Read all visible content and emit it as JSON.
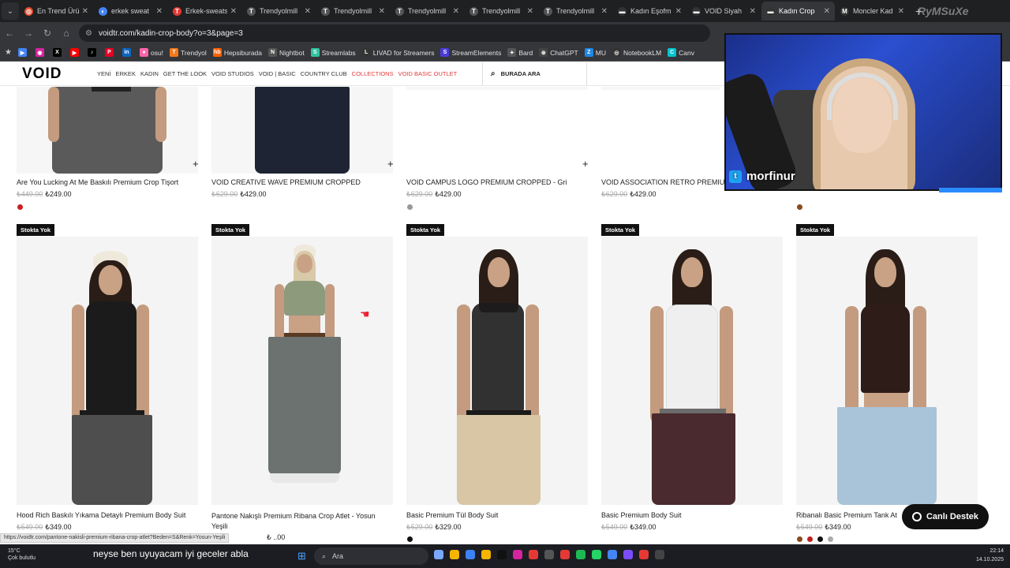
{
  "browser": {
    "tabs": [
      {
        "title": "En Trend Ürü",
        "icon_color": "#e54b2b",
        "icon_glyph": "◎",
        "active": false
      },
      {
        "title": "erkek sweat",
        "icon_color": "#4285f4",
        "icon_glyph": "◐",
        "active": false
      },
      {
        "title": "Erkek-sweats",
        "icon_color": "#e53935",
        "icon_glyph": "T",
        "active": false
      },
      {
        "title": "Trendyolmill",
        "icon_color": "#555",
        "icon_glyph": "T",
        "active": false
      },
      {
        "title": "Trendyolmill",
        "icon_color": "#555",
        "icon_glyph": "T",
        "active": false
      },
      {
        "title": "Trendyolmill",
        "icon_color": "#555",
        "icon_glyph": "T",
        "active": false
      },
      {
        "title": "Trendyolmill",
        "icon_color": "#555",
        "icon_glyph": "T",
        "active": false
      },
      {
        "title": "Trendyolmill",
        "icon_color": "#555",
        "icon_glyph": "T",
        "active": false
      },
      {
        "title": "Kadın Eşofm",
        "icon_color": "#333",
        "icon_glyph": "▬",
        "active": false
      },
      {
        "title": "VOID Siyah",
        "icon_color": "#333",
        "icon_glyph": "▬",
        "active": false
      },
      {
        "title": "Kadın Crop",
        "icon_color": "#333",
        "icon_glyph": "▬",
        "active": true
      },
      {
        "title": "Moncler Kad",
        "icon_color": "#333",
        "icon_glyph": "M",
        "active": false
      }
    ],
    "url": "voidtr.com/kadin-crop-body?o=3&page=3",
    "bookmarks": [
      {
        "label": "",
        "color": "#4285f4",
        "glyph": "▶"
      },
      {
        "label": "",
        "color": "#d6249f",
        "glyph": "◉"
      },
      {
        "label": "",
        "color": "#000",
        "glyph": "X"
      },
      {
        "label": "",
        "color": "#ff0000",
        "glyph": "▶"
      },
      {
        "label": "",
        "color": "#000",
        "glyph": "♪"
      },
      {
        "label": "",
        "color": "#e60023",
        "glyph": "P"
      },
      {
        "label": "",
        "color": "#0a66c2",
        "glyph": "in"
      },
      {
        "label": "osu!",
        "color": "#ff66aa",
        "glyph": "●"
      },
      {
        "label": "Trendyol",
        "color": "#f27a1a",
        "glyph": "T"
      },
      {
        "label": "Hepsiburada",
        "color": "#ff6000",
        "glyph": "hb"
      },
      {
        "label": "Nightbot",
        "color": "#555",
        "glyph": "N"
      },
      {
        "label": "Streamlabs",
        "color": "#31c3a2",
        "glyph": "S"
      },
      {
        "label": "LIVAD for Streamers",
        "color": "#333",
        "glyph": "L"
      },
      {
        "label": "StreamElements",
        "color": "#4b3bdb",
        "glyph": "S"
      },
      {
        "label": "Bard",
        "color": "#555",
        "glyph": "✦"
      },
      {
        "label": "ChatGPT",
        "color": "#444",
        "glyph": "⊛"
      },
      {
        "label": "MU",
        "color": "#1e88e5",
        "glyph": "Z"
      },
      {
        "label": "NotebookLM",
        "color": "#333",
        "glyph": "◎"
      },
      {
        "label": "Canv",
        "color": "#00c4cc",
        "glyph": "C"
      }
    ]
  },
  "site": {
    "logo": "VOID",
    "menu": [
      {
        "label": "YENİ",
        "red": false
      },
      {
        "label": "ERKEK",
        "red": false
      },
      {
        "label": "KADIN",
        "red": false
      },
      {
        "label": "GET THE LOOK",
        "red": false
      },
      {
        "label": "VOID STUDIOS",
        "red": false
      },
      {
        "label": "VOID | BASIC",
        "red": false
      },
      {
        "label": "COUNTRY CLUB",
        "red": false
      },
      {
        "label": "COLLECTIONS",
        "red": true
      },
      {
        "label": "VOID BASIC OUTLET",
        "red": true
      }
    ],
    "search_placeholder": "BURADA ARA"
  },
  "products_top": [
    {
      "name": "Are You Lucking At Me Baskılı Premium Crop Tişort",
      "old_price": "₺449.00",
      "price": "₺249.00",
      "swatches": [
        "#cc1f1f"
      ]
    },
    {
      "name": "VOID CREATIVE WAVE PREMIUM CROPPED",
      "old_price": "₺629.00",
      "price": "₺429.00",
      "swatches": []
    },
    {
      "name": "VOID CAMPUS LOGO PREMIUM CROPPED - Gri",
      "old_price": "₺629.00",
      "price": "₺429.00",
      "swatches": [
        "#999999"
      ]
    },
    {
      "name": "VOID ASSOCIATION RETRO PREMIUM",
      "old_price": "₺629.00",
      "price": "₺429.00",
      "swatches": []
    },
    {
      "name": "",
      "old_price": "",
      "price": "",
      "swatches": [
        "#8a4a1a"
      ]
    }
  ],
  "products_bottom": [
    {
      "badge": "Stokta Yok",
      "name": "Hood Rich Baskılı Yıkama Detaylı Premium Body Suit",
      "old_price": "₺549.00",
      "price": "₺349.00",
      "swatches": []
    },
    {
      "badge": "Stokta Yok",
      "name": "Pantone Nakışlı Premium Ribana Crop Atlet - Yosun Yeşili",
      "old_price": "",
      "price": "₺ ..00",
      "swatches": []
    },
    {
      "badge": "Stokta Yok",
      "name": "Basic Premium Tül Body Suit",
      "old_price": "₺529.00",
      "price": "₺329.00",
      "swatches": [
        "#111111"
      ]
    },
    {
      "badge": "Stokta Yok",
      "name": "Basic Premium Body Suit",
      "old_price": "₺549.00",
      "price": "₺349.00",
      "swatches": []
    },
    {
      "badge": "Stokta Yok",
      "name": "Ribanalı Basic Premium Tank At",
      "old_price": "₺549.00",
      "price": "₺349.00",
      "swatches": [
        "#8a4a1a",
        "#c01f1f",
        "#111111",
        "#aaaaaa"
      ]
    }
  ],
  "overlay": {
    "streamer_handle": "morfinur",
    "brand_watermark": "RyMSuXe"
  },
  "chat_button": "Canlı Destek",
  "status_url": "https://voidtr.com/pantone-nakisli-premium-ribana-crop-atlet?Beden=S&Renk=Yosun-Yeşili",
  "taskbar": {
    "weather_temp": "15°C",
    "weather_text": "Çok bulutlu",
    "chat_line": "neyse ben uyuyacam iyi geceler abla",
    "search_label": "Ara",
    "time": "22:14",
    "date": "14.10.2025",
    "app_colors": [
      "#7aa7ff",
      "#f4b400",
      "#3b82f6",
      "#f4b400",
      "#111",
      "#d6249f",
      "#e53935",
      "#555",
      "#e53935",
      "#1db954",
      "#25d366",
      "#4285f4",
      "#7c4dff",
      "#e53935",
      "#444"
    ]
  }
}
